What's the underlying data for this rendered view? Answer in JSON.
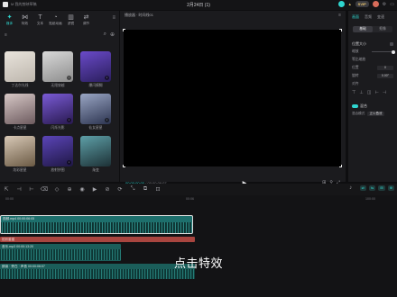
{
  "titlebar": {
    "left_text": "M 我的剪映草稿",
    "center_title": "2月24日 (1)",
    "vip_label": "SVIP",
    "vip_badge": "▲",
    "menu_icons": [
      "gear-icon",
      "layout-icon",
      "minus-icon",
      "close-icon"
    ]
  },
  "media_tabs": [
    {
      "label": "媒体",
      "icon": "✦",
      "active": true
    },
    {
      "label": "特效",
      "icon": "⋈",
      "active": false
    },
    {
      "label": "文本",
      "icon": "T",
      "active": false
    },
    {
      "label": "贴纸动画",
      "icon": "◔",
      "active": false
    },
    {
      "label": "滤镜",
      "icon": "▥",
      "active": false
    },
    {
      "label": "调节",
      "icon": "⇄",
      "active": false
    }
  ],
  "media_subbar": {
    "left": "≡",
    "right_icons": [
      "⌕",
      "⊕"
    ]
  },
  "effects": [
    {
      "caption": "丁达尔光线",
      "colors": [
        "#e9e4dc",
        "#bdb6ad"
      ],
      "downloaded": false
    },
    {
      "caption": "无限穿越",
      "colors": [
        "#d9d9d9",
        "#8d8d8d"
      ],
      "downloaded": true
    },
    {
      "caption": "爆闪模糊",
      "colors": [
        "#6a4ac9",
        "#2a1e5c"
      ],
      "downloaded": true
    },
    {
      "caption": "卡点星星",
      "colors": [
        "#d7c8c6",
        "#6d5b5f"
      ],
      "downloaded": false
    },
    {
      "caption": "闪烁光影",
      "colors": [
        "#7a5bd6",
        "#28194f"
      ],
      "downloaded": true
    },
    {
      "caption": "仙女星星",
      "colors": [
        "#9aa6c4",
        "#2c3450"
      ],
      "downloaded": true
    },
    {
      "caption": "炫彩星星",
      "colors": [
        "#d8c9b7",
        "#6b5a44"
      ],
      "downloaded": false
    },
    {
      "caption": "放射拼图",
      "colors": [
        "#5b45b8",
        "#1f1745"
      ],
      "downloaded": true
    },
    {
      "caption": "渐变",
      "colors": [
        "#5ea0a8",
        "#1d3136"
      ],
      "downloaded": false
    }
  ],
  "player": {
    "title": "播放器 · 时间线01",
    "menu": "≡",
    "current_time": "00:00:00:00",
    "total_time": "00:00:06:07",
    "play_icon": "▶",
    "foot_icons": [
      "⊞",
      "⚲",
      "⤢"
    ]
  },
  "props": {
    "tabs": [
      "画面",
      "音频",
      "变速"
    ],
    "active_tab": "画面",
    "segment": [
      "基础",
      "抠像"
    ],
    "active_segment": "基础",
    "section_position": "位置大小",
    "scale_label": "缩放",
    "scale_slider_fraction": 1.0,
    "uniform_label": "等比缩放",
    "pos_label": "位置",
    "pos_value": "0",
    "rotate_label": "旋转",
    "rotate_value": "0.00°",
    "align_label": "对齐",
    "align_icons": [
      "⊤",
      "⊥",
      "◫",
      "⊢",
      "⊣"
    ],
    "mix_label": "混合",
    "mix_mode_label": "混合模式",
    "mix_mode_value": "正片叠底"
  },
  "toolbar": {
    "tools": [
      "⇱",
      "⊣",
      "⊢",
      "⌫",
      "◇",
      "⊕",
      "◉",
      "▶",
      "⊘",
      "⟳",
      "⤡",
      "⧉",
      "⊡"
    ],
    "right_pills": [
      "⇌",
      "⇋",
      "⊞",
      "⊕"
    ],
    "mic_icon": "♪"
  },
  "timeline": {
    "ruler": [
      "00:00",
      "00:06",
      "100:00"
    ],
    "main_clip": "视频.mp4  00:00:06:05",
    "effect_clip": "炫彩星星",
    "audio1": "音乐.mp3  00:00:13:20",
    "audio2": "朗读 · 旁白 · 声音  00:00:06:07"
  },
  "subtitle": "点击特效"
}
